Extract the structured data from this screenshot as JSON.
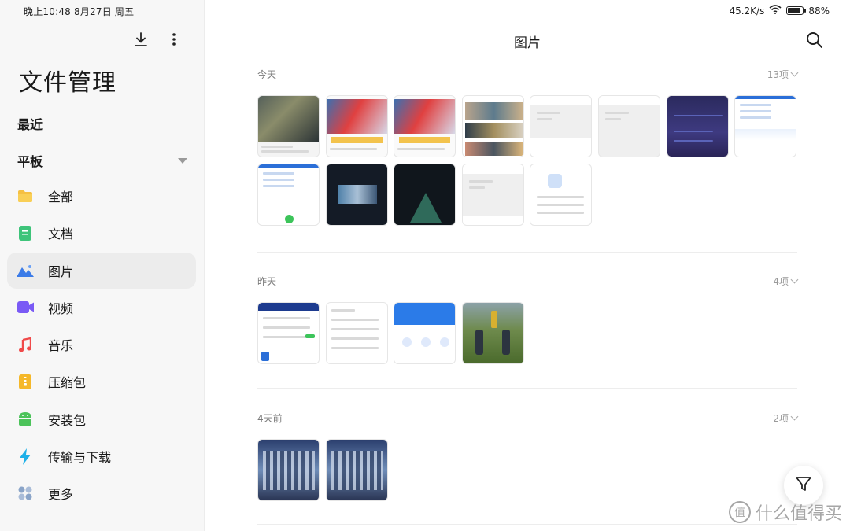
{
  "status": {
    "time_date": "晚上10:48  8月27日 周五",
    "speed": "45.2K/s",
    "battery": "88%",
    "battery_level": 0.88
  },
  "sidebar": {
    "app_title": "文件管理",
    "recent_label": "最近",
    "tablet_label": "平板",
    "icons": {
      "download": "download-icon",
      "more": "more-vertical-icon",
      "expand": "caret-down-icon"
    },
    "items": [
      {
        "label": "全部",
        "icon": "folder-icon",
        "color": "#f5c043"
      },
      {
        "label": "文档",
        "icon": "document-icon",
        "color": "#3ec47a"
      },
      {
        "label": "图片",
        "icon": "image-icon",
        "color": "#3b7be8",
        "active": true
      },
      {
        "label": "视频",
        "icon": "video-icon",
        "color": "#7a5af5"
      },
      {
        "label": "音乐",
        "icon": "music-icon",
        "color": "#f04a4a"
      },
      {
        "label": "压缩包",
        "icon": "archive-icon",
        "color": "#f5b82a"
      },
      {
        "label": "安装包",
        "icon": "android-icon",
        "color": "#4cc35a"
      },
      {
        "label": "传输与下载",
        "icon": "lightning-icon",
        "color": "#1eb0e8"
      },
      {
        "label": "更多",
        "icon": "grid-dots-icon",
        "color": "#8aa4c8"
      }
    ]
  },
  "main": {
    "title": "图片",
    "search_icon": "search-icon",
    "filter_icon": "filter-icon",
    "groups": [
      {
        "date": "今天",
        "count": "13项",
        "num": 13
      },
      {
        "date": "昨天",
        "count": "4项",
        "num": 4
      },
      {
        "date": "4天前",
        "count": "2项",
        "num": 2
      }
    ]
  },
  "watermark": {
    "logo": "值",
    "text": "什么值得买"
  }
}
